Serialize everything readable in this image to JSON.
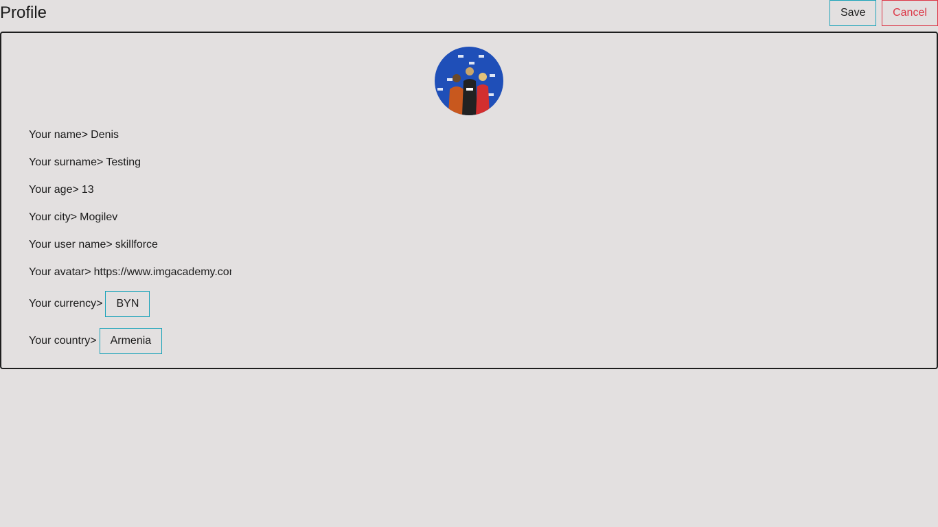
{
  "header": {
    "title": "Profile",
    "save_label": "Save",
    "cancel_label": "Cancel"
  },
  "profile": {
    "avatar_icon": "profile-photo",
    "fields": {
      "name": {
        "label": "Your name>",
        "value": "Denis"
      },
      "surname": {
        "label": "Your surname>",
        "value": "Testing"
      },
      "age": {
        "label": "Your age>",
        "value": "13"
      },
      "city": {
        "label": "Your city>",
        "value": "Mogilev"
      },
      "username": {
        "label": "Your user name>",
        "value": "skillforce"
      },
      "avatar": {
        "label": "Your avatar>",
        "value": "https://www.imgacademy.com"
      },
      "currency": {
        "label": "Your currency>",
        "value": "BYN"
      },
      "country": {
        "label": "Your country>",
        "value": "Armenia"
      }
    }
  },
  "colors": {
    "background": "#e3e0e0",
    "accent_teal": "#17a2b8",
    "danger_red": "#dc3545",
    "avatar_blue": "#1f4fb8"
  }
}
